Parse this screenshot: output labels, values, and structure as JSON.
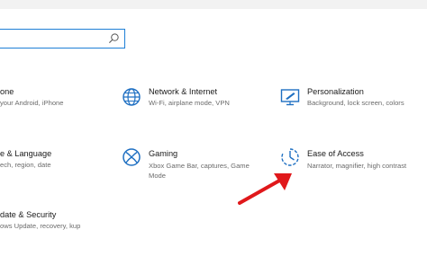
{
  "search": {
    "value": "",
    "placeholder": ""
  },
  "tiles": {
    "phone": {
      "title": "one",
      "desc": "your Android, iPhone"
    },
    "network": {
      "title": "Network & Internet",
      "desc": "Wi-Fi, airplane mode, VPN"
    },
    "personalization": {
      "title": "Personalization",
      "desc": "Background, lock screen, colors"
    },
    "time_language": {
      "title": "e & Language",
      "desc": "ech, region, date"
    },
    "gaming": {
      "title": "Gaming",
      "desc": "Xbox Game Bar, captures, Game Mode"
    },
    "ease_of_access": {
      "title": "Ease of Access",
      "desc": "Narrator, magnifier, high contrast"
    },
    "update_security": {
      "title": "date & Security",
      "desc": "ows Update, recovery, kup"
    }
  },
  "colors": {
    "accent": "#1e7fd6",
    "icon": "#1e6fc2",
    "arrow": "#e0181b"
  }
}
